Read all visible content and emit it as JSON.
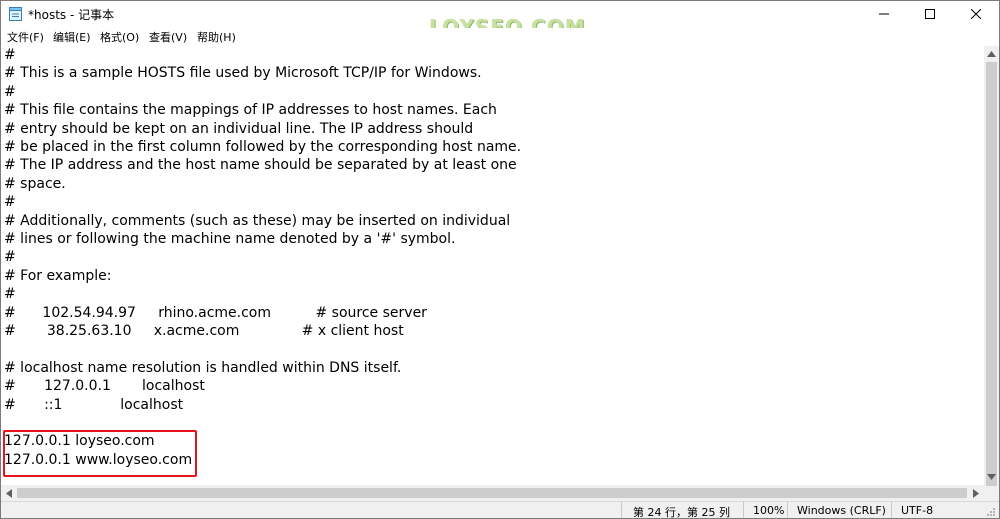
{
  "window": {
    "title": "*hosts - 记事本",
    "watermark": "LOYSEO.COM"
  },
  "title_controls": [
    "minimize-icon",
    "maximize-icon",
    "close-icon"
  ],
  "menu": {
    "items": [
      {
        "label": "文件(F)"
      },
      {
        "label": "编辑(E)"
      },
      {
        "label": "格式(O)"
      },
      {
        "label": "查看(V)"
      },
      {
        "label": "帮助(H)"
      }
    ]
  },
  "editor": {
    "lines": [
      "#",
      "# This is a sample HOSTS file used by Microsoft TCP/IP for Windows.",
      "#",
      "# This file contains the mappings of IP addresses to host names. Each",
      "# entry should be kept on an individual line. The IP address should",
      "# be placed in the first column followed by the corresponding host name.",
      "# The IP address and the host name should be separated by at least one",
      "# space.",
      "#",
      "# Additionally, comments (such as these) may be inserted on individual",
      "# lines or following the machine name denoted by a '#' symbol.",
      "#",
      "# For example:",
      "#",
      "#      102.54.94.97     rhino.acme.com          # source server",
      "#       38.25.63.10     x.acme.com              # x client host",
      "",
      "# localhost name resolution is handled within DNS itself.",
      "#\t127.0.0.1       localhost",
      "#\t::1             localhost",
      "",
      "127.0.0.1 loyseo.com",
      "127.0.0.1 www.loyseo.com"
    ]
  },
  "status": {
    "position": "第 24 行，第 25 列",
    "zoom": "100%",
    "line_ending": "Windows (CRLF)",
    "encoding": "UTF-8"
  },
  "colors": {
    "highlight_border": "#e8141c",
    "watermark": "#c8e0a0"
  }
}
